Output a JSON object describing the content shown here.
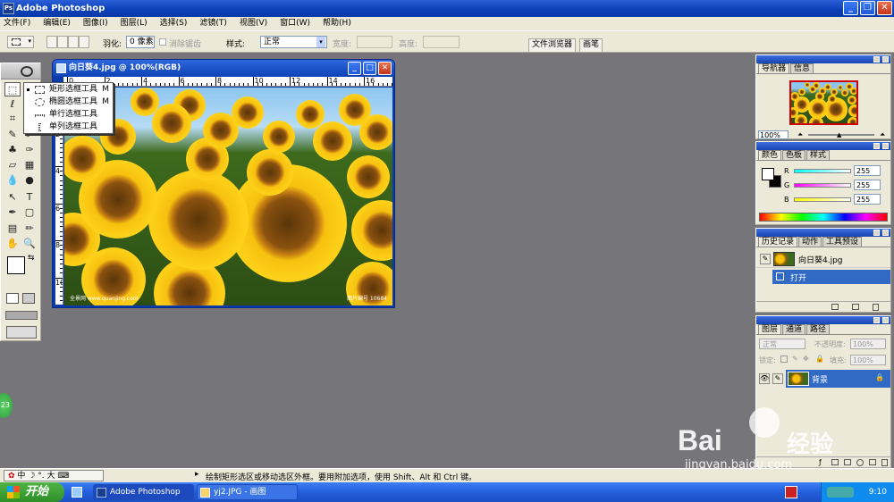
{
  "app": {
    "title": "Adobe Photoshop",
    "title_icon": "Ps"
  },
  "menu": [
    "文件(F)",
    "编辑(E)",
    "图像(I)",
    "图层(L)",
    "选择(S)",
    "滤镜(T)",
    "视图(V)",
    "窗口(W)",
    "帮助(H)"
  ],
  "options": {
    "feather_label": "羽化:",
    "feather_value": "0 像素",
    "antialias_label": "消除锯齿",
    "style_label": "样式:",
    "style_value": "正常",
    "width_label": "宽度:",
    "height_label": "高度:",
    "tab_file_browser": "文件浏览器",
    "tab_brushes": "画笔"
  },
  "flyout": {
    "items": [
      {
        "label": "矩形选框工具",
        "key": "M"
      },
      {
        "label": "椭圆选框工具",
        "key": "M"
      },
      {
        "label": "单行选框工具",
        "key": ""
      },
      {
        "label": "单列选框工具",
        "key": ""
      }
    ]
  },
  "document": {
    "title": "向日葵4.jpg @ 100%(RGB)",
    "ruler_h": [
      "0",
      "2",
      "4",
      "6",
      "8",
      "10",
      "12",
      "14",
      "16"
    ],
    "ruler_v": [
      "0",
      "2",
      "4",
      "6",
      "8",
      "10"
    ],
    "watermark_left": "全景网 www.quanjing.com",
    "watermark_right": "图片编号 10684"
  },
  "navigator": {
    "tabs": [
      "导航器",
      "信息"
    ],
    "zoom": "100%"
  },
  "color": {
    "tabs": [
      "颜色",
      "色板",
      "样式"
    ],
    "r_label": "R",
    "r_value": "255",
    "g_label": "G",
    "g_value": "255",
    "b_label": "B",
    "b_value": "255"
  },
  "history": {
    "tabs": [
      "历史记录",
      "动作",
      "工具预设"
    ],
    "snapshot": "向日葵4.jpg",
    "step": "打开"
  },
  "layers": {
    "tabs": [
      "图层",
      "通道",
      "路径"
    ],
    "blend": "正常",
    "opacity_label": "不透明度:",
    "opacity": "100%",
    "lock_label": "锁定:",
    "fill_label": "填充:",
    "fill": "100%",
    "layer_name": "背景"
  },
  "status": {
    "hint": "绘制矩形选区或移动选区外框。要用附加选项，使用 Shift、Alt 和 Ctrl 键。",
    "ime": "中",
    "ime_mode": "大"
  },
  "taskbar": {
    "start": "开始",
    "tasks": [
      "Adobe Photoshop",
      "yj2.JPG - 画图"
    ],
    "time": "9:10"
  },
  "badge": "23",
  "watermark_brand": "Bai",
  "watermark_brand2": "经验",
  "watermark_url": "jingyan.baidu.com",
  "colors": {
    "titlebar": "#0a3fb6",
    "workspace": "#767579",
    "panel": "#ece9d8",
    "selection": "#316ac5",
    "start": "#2f8f28"
  }
}
